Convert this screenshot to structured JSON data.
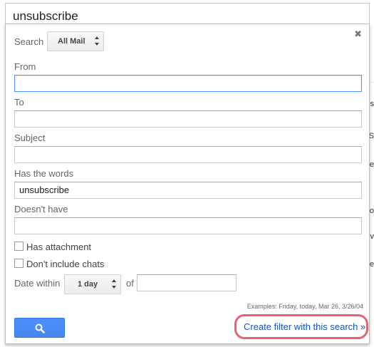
{
  "search_query": "unsubscribe",
  "panel": {
    "search_label": "Search",
    "scope_value": "All Mail",
    "from_label": "From",
    "from_value": "",
    "to_label": "To",
    "to_value": "",
    "subject_label": "Subject",
    "subject_value": "",
    "has_words_label": "Has the words",
    "has_words_value": "unsubscribe",
    "doesnt_have_label": "Doesn't have",
    "doesnt_have_value": "",
    "has_attachment_label": "Has attachment",
    "has_attachment_checked": false,
    "no_chats_label": "Don't include chats",
    "no_chats_checked": false,
    "date_within_label": "Date within",
    "date_range_value": "1 day",
    "of_label": "of",
    "date_value": "",
    "examples_text": "Examples: Friday, today, Mar 26, 3/26/04",
    "create_filter_label": "Create filter with this search »"
  },
  "background_chars": [
    "s",
    "S",
    "e",
    "o",
    "v",
    "e"
  ],
  "colors": {
    "accent_blue": "#4d90fe",
    "link_blue": "#1155cc",
    "highlight_ring": "#e4646f"
  }
}
